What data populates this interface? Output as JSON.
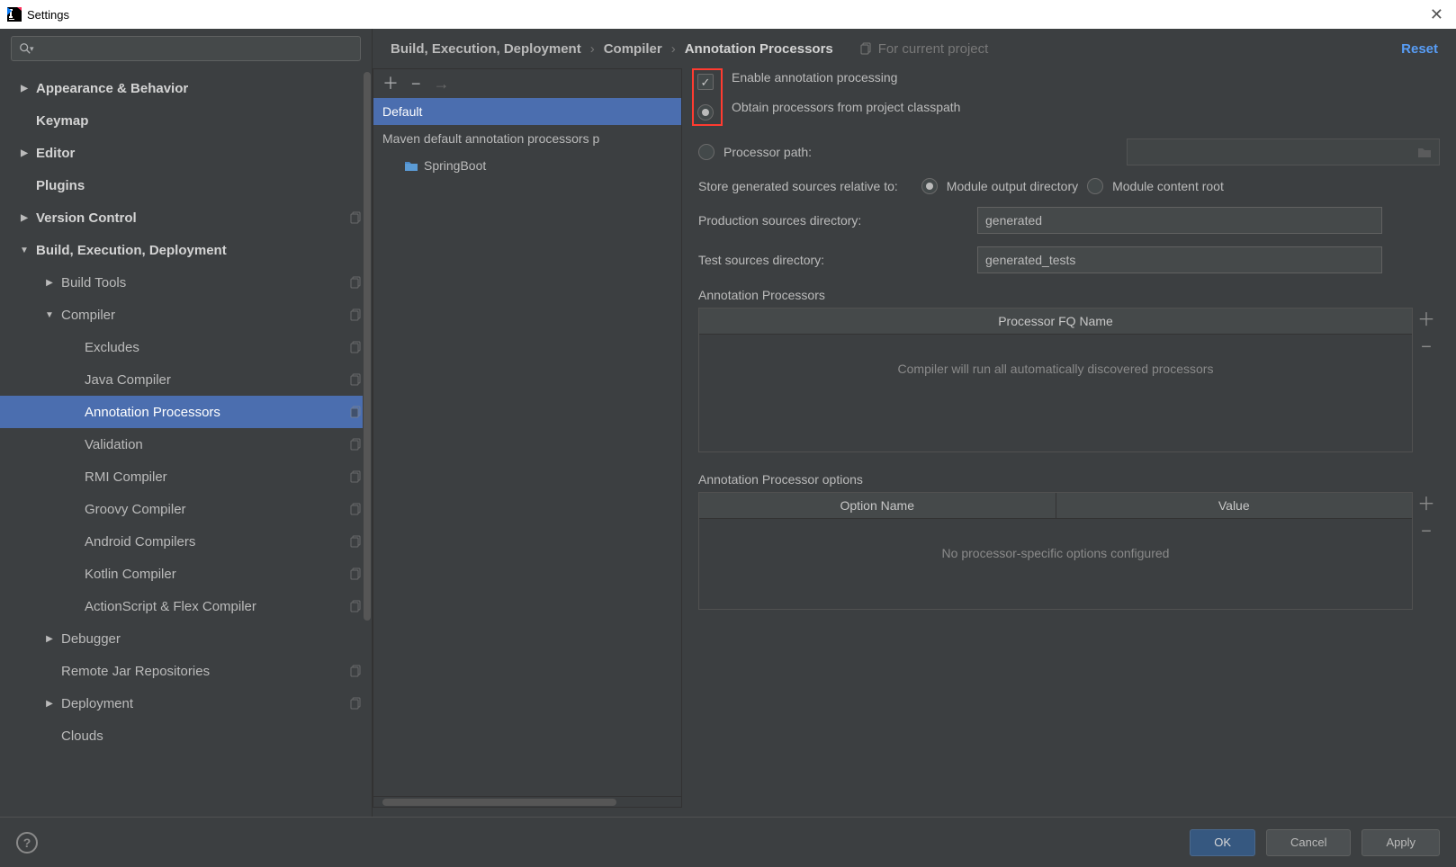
{
  "window": {
    "title": "Settings"
  },
  "sidebar": {
    "items": [
      {
        "label": "Appearance & Behavior",
        "bold": true,
        "arrow": "right",
        "indent": 0
      },
      {
        "label": "Keymap",
        "bold": true,
        "indent": 0
      },
      {
        "label": "Editor",
        "bold": true,
        "arrow": "right",
        "indent": 0
      },
      {
        "label": "Plugins",
        "bold": true,
        "indent": 0
      },
      {
        "label": "Version Control",
        "bold": true,
        "arrow": "right",
        "indent": 0,
        "copy": true
      },
      {
        "label": "Build, Execution, Deployment",
        "bold": true,
        "arrow": "down",
        "indent": 0
      },
      {
        "label": "Build Tools",
        "arrow": "right",
        "indent": 1,
        "copy": true
      },
      {
        "label": "Compiler",
        "arrow": "down",
        "indent": 1,
        "copy": true
      },
      {
        "label": "Excludes",
        "indent": 2,
        "copy": true
      },
      {
        "label": "Java Compiler",
        "indent": 2,
        "copy": true
      },
      {
        "label": "Annotation Processors",
        "indent": 2,
        "copy": true,
        "selected": true
      },
      {
        "label": "Validation",
        "indent": 2,
        "copy": true
      },
      {
        "label": "RMI Compiler",
        "indent": 2,
        "copy": true
      },
      {
        "label": "Groovy Compiler",
        "indent": 2,
        "copy": true
      },
      {
        "label": "Android Compilers",
        "indent": 2,
        "copy": true
      },
      {
        "label": "Kotlin Compiler",
        "indent": 2,
        "copy": true
      },
      {
        "label": "ActionScript & Flex Compiler",
        "indent": 2,
        "copy": true
      },
      {
        "label": "Debugger",
        "arrow": "right",
        "indent": 1
      },
      {
        "label": "Remote Jar Repositories",
        "indent": 1,
        "copy": true
      },
      {
        "label": "Deployment",
        "arrow": "right",
        "indent": 1,
        "copy": true
      },
      {
        "label": "Clouds",
        "indent": 1
      }
    ]
  },
  "breadcrumbs": {
    "seg1": "Build, Execution, Deployment",
    "seg2": "Compiler",
    "seg3": "Annotation Processors",
    "hint": "For current project",
    "reset": "Reset"
  },
  "profiles": {
    "items": [
      {
        "label": "Default",
        "selected": true
      },
      {
        "label": "Maven default annotation processors p"
      },
      {
        "label": "SpringBoot",
        "indent": true,
        "folder": true
      }
    ]
  },
  "form": {
    "enable_label": "Enable annotation processing",
    "obtain_label": "Obtain processors from project classpath",
    "path_label": "Processor path:",
    "store_label": "Store generated sources relative to:",
    "store_opt1": "Module output directory",
    "store_opt2": "Module content root",
    "prod_label": "Production sources directory:",
    "prod_value": "generated",
    "test_label": "Test sources directory:",
    "test_value": "generated_tests",
    "fset1_title": "Annotation Processors",
    "fset1_header": "Processor FQ Name",
    "fset1_empty": "Compiler will run all automatically discovered processors",
    "fset2_title": "Annotation Processor options",
    "fset2_h1": "Option Name",
    "fset2_h2": "Value",
    "fset2_empty": "No processor-specific options configured"
  },
  "footer": {
    "ok": "OK",
    "cancel": "Cancel",
    "apply": "Apply"
  }
}
